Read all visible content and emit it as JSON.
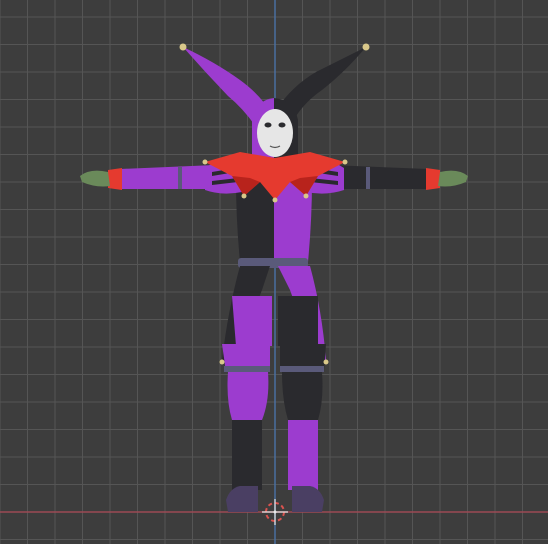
{
  "viewport": {
    "view": "front-orthographic",
    "grid": true,
    "colors": {
      "background": "#3d3d3d",
      "grid_minor": "#4a4a4a",
      "grid_major": "#555555",
      "axis_x": "#9b4a55",
      "axis_z": "#4a6fa0",
      "cursor": "#e8e8e8",
      "cursor_accent": "#d9534f"
    }
  },
  "model": {
    "subject": "jester",
    "pose": "t-pose",
    "colors": {
      "purple": "#9c3ccf",
      "purple_dark": "#7a2aa8",
      "black": "#2a2a2e",
      "black_light": "#3a3a40",
      "red": "#e53a2f",
      "red_dark": "#b8231c",
      "mask": "#e6e6e6",
      "skin_green": "#6a8a5a",
      "belt": "#5a5a7a",
      "bell": "#d9c88a",
      "shoe": "#4a3f63"
    }
  }
}
